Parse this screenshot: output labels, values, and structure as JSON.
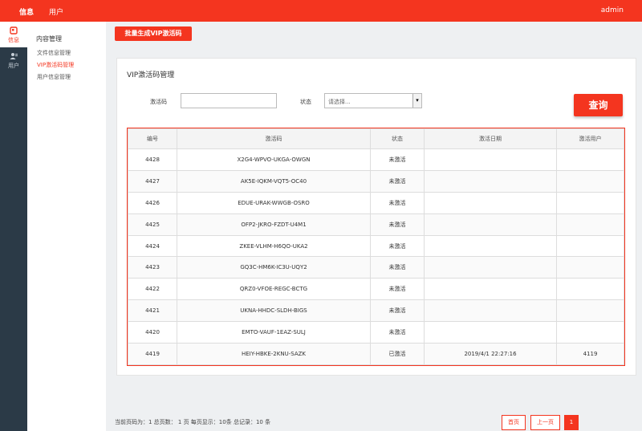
{
  "header": {
    "nav": [
      "信息",
      "用户"
    ],
    "user": "admin"
  },
  "leftbar": {
    "items": [
      "信息",
      "用户"
    ]
  },
  "subnav": {
    "title": "内容管理",
    "items": [
      "文件信息管理",
      "VIP激活码管理",
      "用户信息管理"
    ]
  },
  "toolbar": {
    "batch_label": "批量生成VIP激活码"
  },
  "panel": {
    "title": "VIP激活码管理",
    "code_label": "激活码",
    "code_value": "",
    "status_label": "状态",
    "status_selected": "请选择...",
    "query_label": "查询"
  },
  "table": {
    "columns": [
      "编号",
      "激活码",
      "状态",
      "激活日期",
      "激活用户"
    ],
    "rows": [
      [
        "4428",
        "X2G4-WPVO-UKGA-OWGN",
        "未激活",
        "",
        ""
      ],
      [
        "4427",
        "AK5E-IQKM-VQT5-OC40",
        "未激活",
        "",
        ""
      ],
      [
        "4426",
        "EDUE-URAK-WWGB-OSRO",
        "未激活",
        "",
        ""
      ],
      [
        "4425",
        "OFP2-JKRO-FZDT-U4M1",
        "未激活",
        "",
        ""
      ],
      [
        "4424",
        "ZKEE-VLHM-H6QO-UKA2",
        "未激活",
        "",
        ""
      ],
      [
        "4423",
        "GQ3C-HM6K-IC3U-UQY2",
        "未激活",
        "",
        ""
      ],
      [
        "4422",
        "QRZ0-VFOE-REGC-BCTG",
        "未激活",
        "",
        ""
      ],
      [
        "4421",
        "UKNA-HHDC-SLDH-BIGS",
        "未激活",
        "",
        ""
      ],
      [
        "4420",
        "EMTO-VAUF-1EAZ-SULJ",
        "未激活",
        "",
        ""
      ],
      [
        "4419",
        "HEIY-HBKE-2KNU-SAZK",
        "已激活",
        "2019/4/1 22:27:16",
        "4119"
      ]
    ]
  },
  "footer": {
    "summary": "当前页码为：1 总页数： 1 页 每页显示：10条 总记录：10 条",
    "first_label": "首页",
    "prev_label": "上一页",
    "current_page": "1"
  },
  "colors": {
    "accent": "#f4351f",
    "sidebar": "#2b3a47"
  },
  "icons": {
    "info": "info-panel-icon",
    "user": "users-icon"
  }
}
